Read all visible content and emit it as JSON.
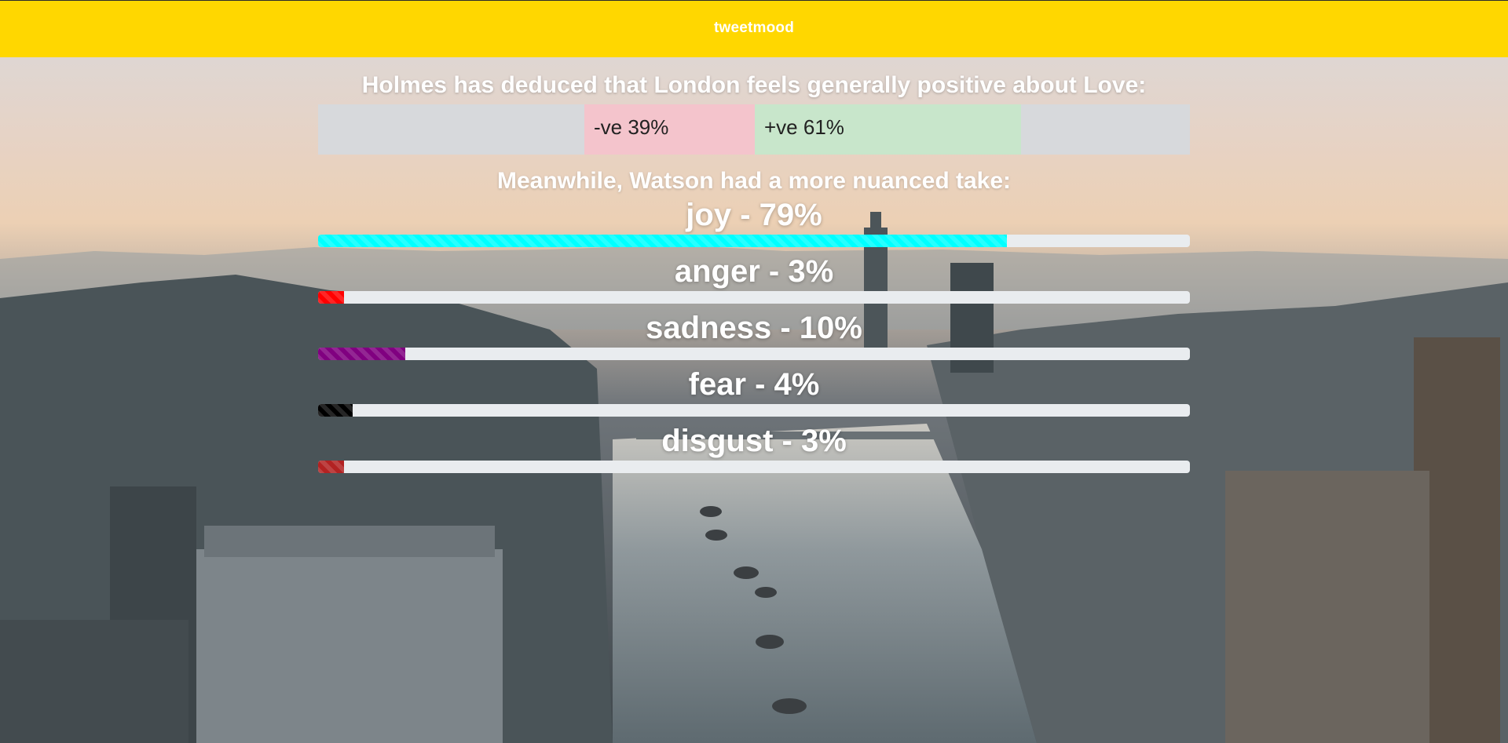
{
  "navbar": {
    "brand": "tweetmood",
    "color": "#ffd700"
  },
  "headline": "Holmes has deduced that London feels generally positive about Love:",
  "sentiment": {
    "negative_label": "-ve 39%",
    "negative_percent": 39,
    "negative_color": "#f4c4cc",
    "positive_label": "+ve 61%",
    "positive_percent": 61,
    "positive_color": "#c8e6cb"
  },
  "subheadline": "Meanwhile, Watson had a more nuanced take:",
  "emotions": [
    {
      "label": "joy - 79%",
      "value": 79,
      "color": "#00ffff"
    },
    {
      "label": "anger - 3%",
      "value": 3,
      "color": "#ff0000"
    },
    {
      "label": "sadness - 10%",
      "value": 10,
      "color": "#800080"
    },
    {
      "label": "fear - 4%",
      "value": 4,
      "color": "#000000"
    },
    {
      "label": "disgust - 3%",
      "value": 3,
      "color": "#b22222"
    }
  ],
  "background": {
    "icon": "london-cityscape-photo"
  }
}
